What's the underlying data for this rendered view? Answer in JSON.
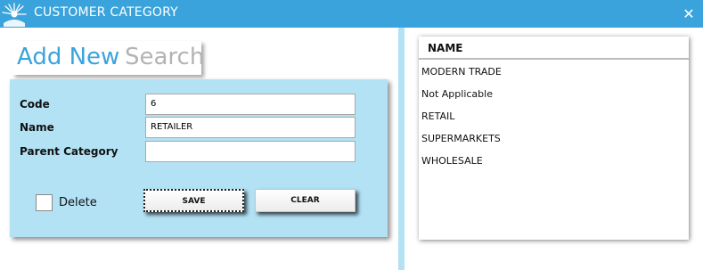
{
  "window": {
    "title": "CUSTOMER CATEGORY",
    "close_icon": "close-icon",
    "accent_color": "#3aa3dc",
    "panel_color": "#b3e2f5"
  },
  "tabs": {
    "add_new": "Add New",
    "search": "Search"
  },
  "form": {
    "code_label": "Code",
    "code_value": "6",
    "name_label": "Name",
    "name_value": "RETAILER",
    "parent_label": "Parent Category",
    "parent_value": "",
    "delete_label": "Delete",
    "save_label": "SAVE",
    "clear_label": "CLEAR"
  },
  "list": {
    "header": "NAME",
    "rows": [
      "MODERN TRADE",
      "Not Applicable",
      "RETAIL",
      "SUPERMARKETS",
      "WHOLESALE"
    ]
  }
}
